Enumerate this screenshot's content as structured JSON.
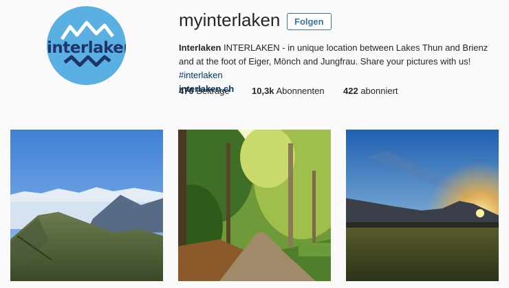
{
  "profile": {
    "avatar_text": "interlaken",
    "username": "myinterlaken",
    "follow_label": "Folgen",
    "bio_name": "Interlaken",
    "bio_text": "INTERLAKEN - in unique location between Lakes Thun and Brienz and at the foot of Eiger, Mönch and Jungfrau. Share your pictures with us!",
    "bio_hashtag": "#interlaken",
    "website": "interlaken.ch"
  },
  "stats": {
    "posts_count": "470",
    "posts_label": "Beiträge",
    "followers_count": "10,3k",
    "followers_label": "Abonnenten",
    "following_count": "422",
    "following_label": "abonniert"
  },
  "posts": [
    {
      "subject": "alpine ridge above sea of clouds"
    },
    {
      "subject": "tree-lined autumn path"
    },
    {
      "subject": "sunset over meadow and mountains"
    }
  ],
  "colors": {
    "accent": "#3f729b",
    "link": "#003569",
    "avatar_bg": "#5bb0e3",
    "avatar_text": "#1d3569"
  }
}
